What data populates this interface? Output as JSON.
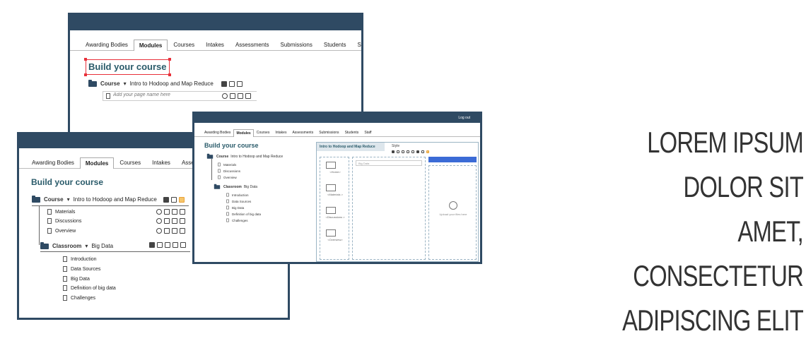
{
  "tabs": [
    "Awarding Bodies",
    "Modules",
    "Courses",
    "Intakes",
    "Assessments",
    "Submissions",
    "Students",
    "Staff"
  ],
  "active_tab": "Modules",
  "page_title": "Build your course",
  "course": {
    "label": "Course",
    "name": "Intro to Hodoop and Map Reduce"
  },
  "page_name_placeholder": "Add your page name here",
  "course_pages": [
    "Materials",
    "Discussions",
    "Overview"
  ],
  "classroom": {
    "label": "Classroom",
    "name": "Big Data"
  },
  "classroom_pages": [
    "Introduction",
    "Data Sources",
    "Big Data",
    "Definition of big data",
    "Challenges"
  ],
  "editor": {
    "logout": "Log out",
    "panel_title": "Intro to Hodoop and Map Reduce",
    "style_label": "Style",
    "search_value": "Big Data",
    "thumbs": [
      "<Home>",
      "<Materials >",
      "<Discussions >",
      "<Overview>"
    ],
    "upload_text": "Upload your files here"
  },
  "tagline": [
    "LOREM IPSUM DOLOR SIT",
    "AMET, CONSECTETUR",
    "ADIPISCING ELIT"
  ],
  "colors": {
    "frame": "#2f4a63",
    "title": "#2a5b6a",
    "accent": "#e8a23a",
    "selection": "#e8303a"
  }
}
